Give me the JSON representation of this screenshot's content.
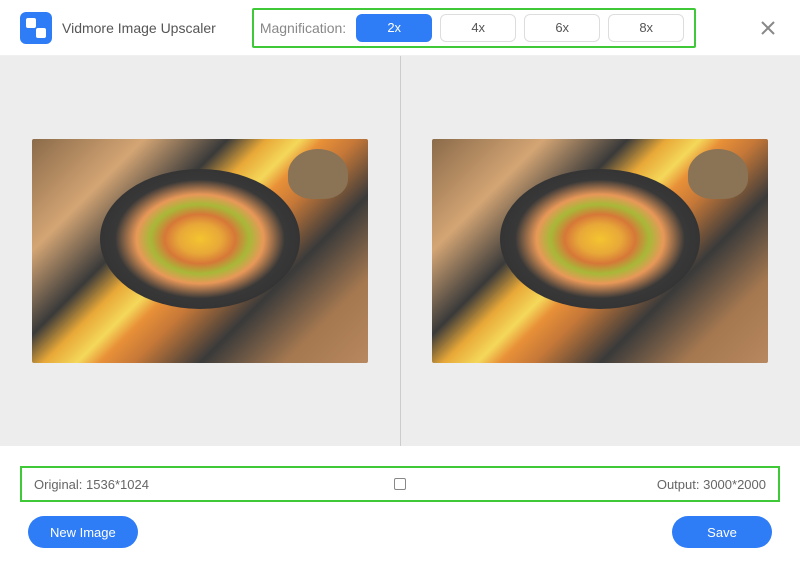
{
  "header": {
    "app_title": "Vidmore Image Upscaler",
    "magnification_label": "Magnification:",
    "magnification_options": [
      "2x",
      "4x",
      "6x",
      "8x"
    ],
    "magnification_selected": "2x"
  },
  "info": {
    "original_label": "Original: 1536*1024",
    "output_label": "Output: 3000*2000"
  },
  "footer": {
    "new_image_label": "New Image",
    "save_label": "Save"
  }
}
